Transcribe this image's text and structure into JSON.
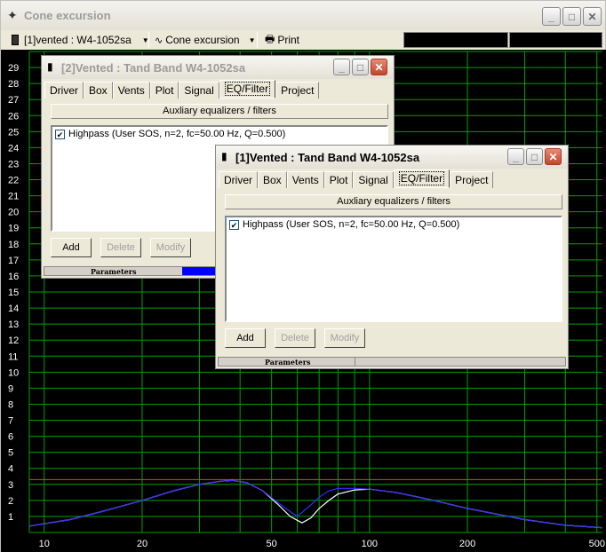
{
  "window": {
    "title": "Cone excursion"
  },
  "toolbar": {
    "project_select": "[1]vented : W4-1052sa",
    "view_select": "Cone excursion",
    "print_label": "Print"
  },
  "chart_data": {
    "type": "line",
    "title": "",
    "xlabel": "",
    "ylabel": "",
    "x_scale": "log",
    "xlim": [
      9,
      520
    ],
    "ylim": [
      0,
      30
    ],
    "x_ticks": [
      "10",
      "20",
      "50",
      "100",
      "200",
      "500"
    ],
    "y_ticks": [
      "1",
      "2",
      "3",
      "4",
      "5",
      "6",
      "7",
      "8",
      "9",
      "10",
      "11",
      "12",
      "13",
      "14",
      "15",
      "16",
      "17",
      "18",
      "19",
      "20",
      "21",
      "22",
      "23",
      "24",
      "25",
      "26",
      "27",
      "28",
      "29"
    ],
    "grid": true,
    "reference_line": {
      "y": 3.3,
      "color": "#ff3030"
    },
    "series": [
      {
        "color": "#ffffff",
        "x": [
          9,
          12,
          15,
          20,
          25,
          30,
          35,
          38,
          42,
          47,
          52,
          57,
          62,
          66,
          70,
          75,
          80,
          90,
          100,
          120,
          150,
          200,
          300,
          400,
          520
        ],
        "y": [
          0.4,
          0.8,
          1.3,
          2.0,
          2.6,
          3.0,
          3.2,
          3.25,
          3.1,
          2.6,
          1.8,
          1.0,
          0.6,
          0.9,
          1.5,
          2.0,
          2.4,
          2.65,
          2.7,
          2.5,
          2.1,
          1.5,
          0.8,
          0.45,
          0.3
        ]
      },
      {
        "color": "#3030ff",
        "x": [
          9,
          12,
          15,
          20,
          25,
          30,
          35,
          38,
          42,
          47,
          52,
          57,
          60,
          65,
          70,
          75,
          80,
          90,
          100,
          120,
          150,
          200,
          300,
          400,
          520
        ],
        "y": [
          0.4,
          0.8,
          1.3,
          2.0,
          2.6,
          3.0,
          3.2,
          3.25,
          3.1,
          2.6,
          1.9,
          1.3,
          1.0,
          1.6,
          2.2,
          2.6,
          2.75,
          2.75,
          2.7,
          2.5,
          2.1,
          1.5,
          0.8,
          0.45,
          0.3
        ]
      }
    ]
  },
  "dialog2": {
    "title": "[2]Vented : Tand Band W4-1052sa",
    "tabs": [
      "Driver",
      "Box",
      "Vents",
      "Plot",
      "Signal",
      "EQ/Filter",
      "Project"
    ],
    "selected_tab": "EQ/Filter",
    "group_label": "Auxliary equalizers / filters",
    "item": "Highpass (User SOS, n=2, fc=50.00 Hz, Q=0.500)",
    "add": "Add",
    "delete": "Delete",
    "modify": "Modify",
    "status": "Parameters"
  },
  "dialog1": {
    "title": "[1]Vented : Tand Band W4-1052sa",
    "tabs": [
      "Driver",
      "Box",
      "Vents",
      "Plot",
      "Signal",
      "EQ/Filter",
      "Project"
    ],
    "selected_tab": "EQ/Filter",
    "group_label": "Auxliary equalizers / filters",
    "item": "Highpass (User SOS, n=2, fc=50.00 Hz, Q=0.500)",
    "add": "Add",
    "delete": "Delete",
    "modify": "Modify",
    "status": "Parameters"
  }
}
